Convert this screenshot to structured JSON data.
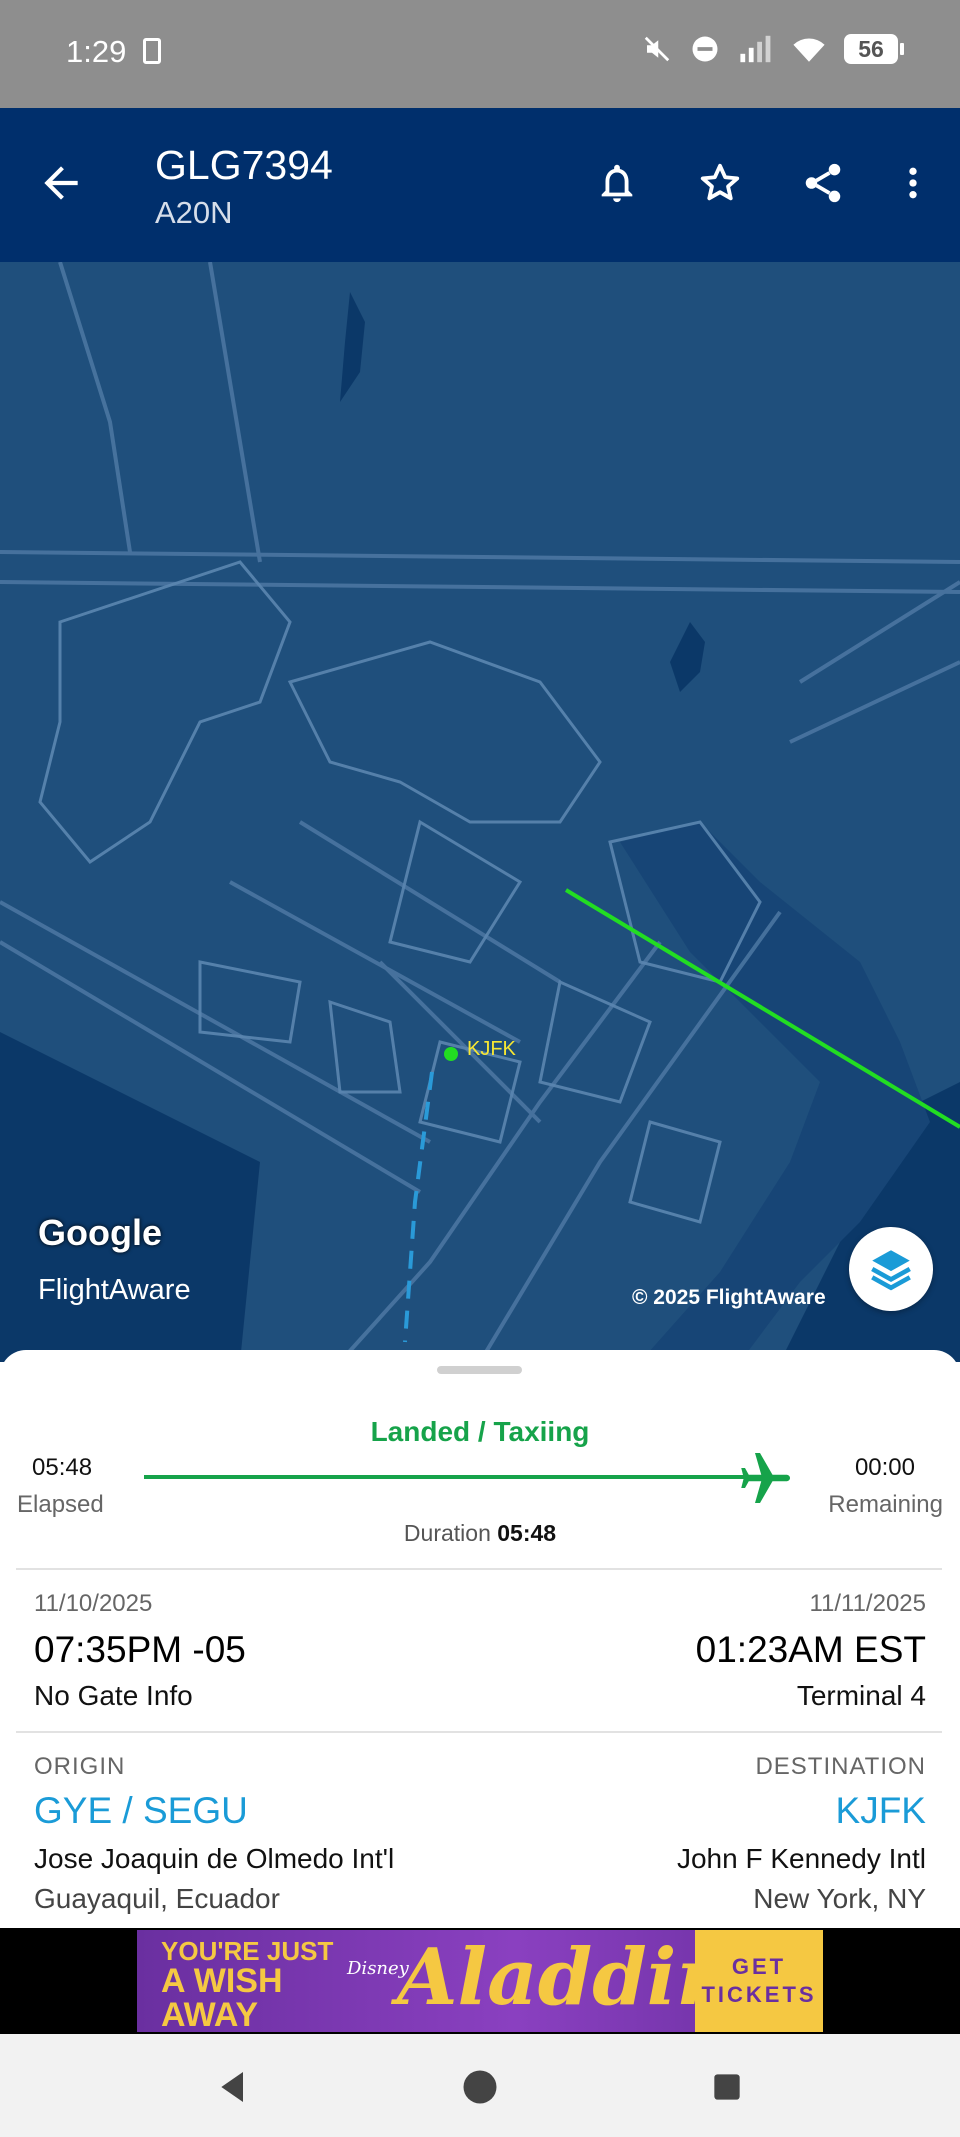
{
  "status_bar": {
    "time": "1:29",
    "battery": "56",
    "icons": [
      "mute-icon",
      "dnd-icon",
      "signal-icon",
      "wifi-icon",
      "battery-icon"
    ]
  },
  "app_bar": {
    "title": "GLG7394",
    "subtitle": "A20N",
    "icons": [
      "back-arrow-icon",
      "bell-icon",
      "star-icon",
      "share-icon",
      "more-vert-icon"
    ]
  },
  "map": {
    "airport_label": "KJFK",
    "google_logo": "Google",
    "flightaware_logo": "FlightAware",
    "copyright": "© 2025 FlightAware",
    "track_color": "#22dd22",
    "water_color": "#0b3868",
    "land_color": "#1f4f7c"
  },
  "flight_status": {
    "status": "Landed / Taxiing",
    "elapsed_time": "05:48",
    "elapsed_label": "Elapsed",
    "remaining_time": "00:00",
    "remaining_label": "Remaining",
    "duration_label": "Duration",
    "duration_value": "05:48",
    "progress": 1.0,
    "status_color": "#16a34a"
  },
  "departure": {
    "date": "11/10/2025",
    "time": "07:35PM -05",
    "gate": "No Gate Info"
  },
  "arrival": {
    "date": "11/11/2025",
    "time": "01:23AM EST",
    "gate": "Terminal 4"
  },
  "origin": {
    "label": "ORIGIN",
    "code": "GYE / SEGU",
    "name": "Jose Joaquin de Olmedo Int'l",
    "city": "Guayaquil, Ecuador"
  },
  "destination": {
    "label": "DESTINATION",
    "code": "KJFK",
    "name": "John F Kennedy Intl",
    "city": "New York, NY"
  },
  "ad": {
    "line1": "YOU'RE JUST",
    "line2": "A WISH",
    "line3": "AWAY",
    "brand": "Disney",
    "title": "Aladdin",
    "cta_line1": "GET",
    "cta_line2": "TICKETS"
  },
  "nav": {
    "icons": [
      "nav-back-icon",
      "nav-home-icon",
      "nav-recents-icon"
    ]
  }
}
